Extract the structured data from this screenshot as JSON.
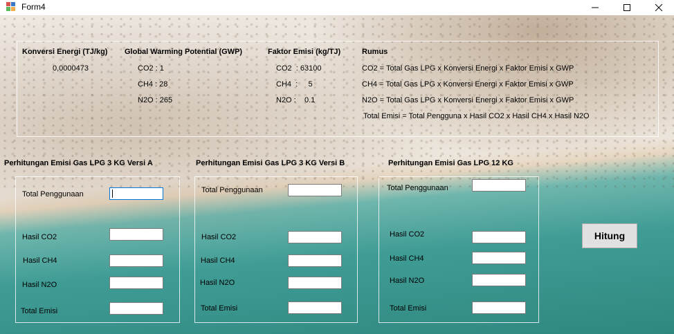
{
  "window": {
    "title": "Form4"
  },
  "info": {
    "headers": {
      "konversi": "Konversi Energi (TJ/kg)",
      "gwp": "Global Warming Potential (GWP)",
      "faktor": "Faktor Emisi (kg/TJ)",
      "rumus": "Rumus"
    },
    "konversi_value": "0,0000473",
    "gwp_rows": [
      "CO2 :  1",
      "CH4 :  28",
      "N2O :  265"
    ],
    "faktor_rows": [
      "CO2  : 63100",
      "CH4  :     5",
      "N2O :    0.1"
    ],
    "rumus_rows": [
      "CO2  =  Total Gas LPG x Konversi Energi x Faktor Emisi x GWP",
      "CH4  =  Total Gas LPG x Konversi Energi x Faktor Emisi x GWP",
      "N2O  =  Total Gas LPG x Konversi Energi x Faktor Emisi x GWP",
      "Total Emisi  =  Total Pengguna x Hasil CO2 x Hasil CH4 x Hasil N2O"
    ]
  },
  "groups": {
    "a": {
      "title": "Perhitungan Emisi Gas LPG 3 KG Versi A",
      "labels": {
        "total_penggunaan": "Total Penggunaan",
        "co2": "Hasil CO2",
        "ch4": "Hasil CH4",
        "n2o": "Hasil N2O",
        "total_emisi": "Total Emisi"
      }
    },
    "b": {
      "title": "Perhitungan Emisi Gas LPG 3 KG Versi B",
      "labels": {
        "total_penggunaan": "Total Penggunaan",
        "co2": "Hasil CO2",
        "ch4": "Hasil CH4",
        "n2o": "Hasil N2O",
        "total_emisi": "Total Emisi"
      }
    },
    "c": {
      "title": "Perhitungan Emisi Gas LPG 12 KG",
      "labels": {
        "total_penggunaan": "Total Penggunaan",
        "co2": "Hasil CO2",
        "ch4": "Hasil CH4",
        "n2o": "Hasil N2O",
        "total_emisi": "Total Emisi"
      }
    }
  },
  "hitung_label": "Hitung",
  "icons": {
    "app": "winforms-app-icon",
    "minimize": "minimize-icon",
    "maximize": "maximize-icon",
    "close": "close-icon"
  }
}
